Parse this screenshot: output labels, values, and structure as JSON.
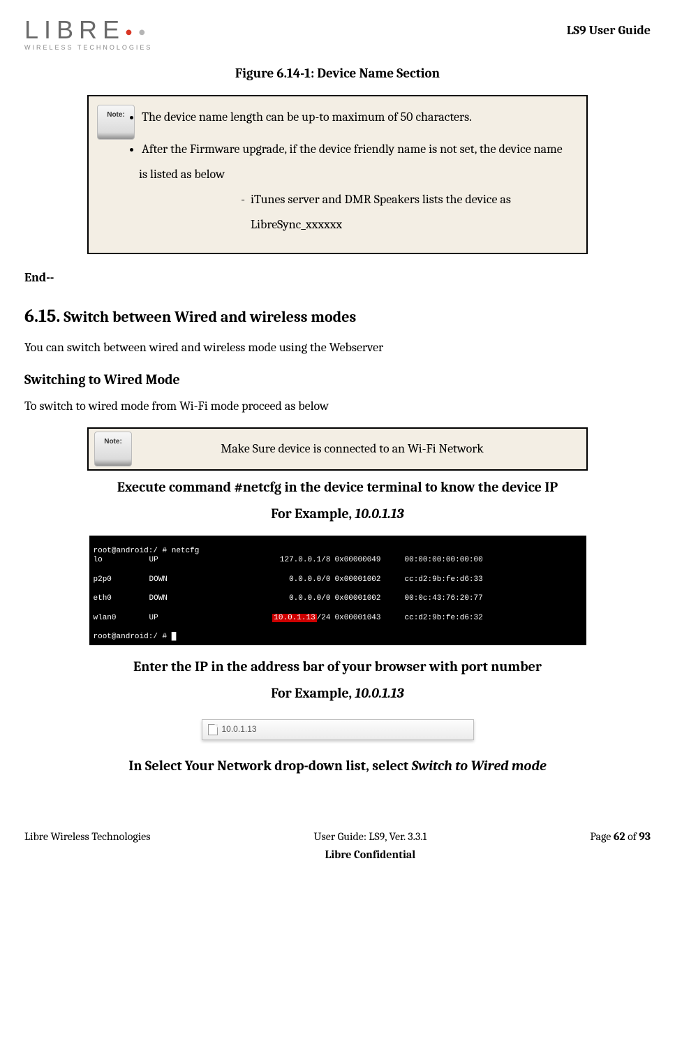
{
  "header": {
    "logo_main": "LIBRE",
    "logo_sub": "WIRELESS TECHNOLOGIES",
    "doc_title": "LS9 User Guide"
  },
  "figure_caption": "Figure 6.14-1: Device Name Section",
  "note1": {
    "icon_label": "Note:",
    "bullet1": "The device name length can be up-to maximum of 50 characters.",
    "bullet2": "After the Firmware upgrade, if the device friendly name is not set,  the device name is listed as below",
    "sub_bullet": "iTunes server and DMR Speakers lists the device as LibreSync_xxxxxx"
  },
  "end_text": "End--",
  "section": {
    "number": "6.15.",
    "title": "Switch between Wired and wireless modes",
    "intro": "You can switch between wired and wireless mode using the Webserver",
    "sub_heading": "Switching to Wired Mode",
    "sub_intro": "To switch to wired mode from Wi-Fi mode proceed as below"
  },
  "note2": {
    "icon_label": "Note:",
    "text": "Make Sure device is connected to an Wi-Fi Network"
  },
  "step1": {
    "line1": "Execute command #netcfg in the device terminal to know the device IP",
    "line2_prefix": "For Example, ",
    "line2_ip": "10.0.1.13"
  },
  "terminal": {
    "prompt1": "root@android:/ # ",
    "cmd": "netcfg",
    "rows": [
      {
        "if": "lo",
        "st": "UP",
        "ip": "127.0.0.1/8",
        "flags": "0x00000049",
        "mac": "00:00:00:00:00:00"
      },
      {
        "if": "p2p0",
        "st": "DOWN",
        "ip": "0.0.0.0/0",
        "flags": "0x00001002",
        "mac": "cc:d2:9b:fe:d6:33"
      },
      {
        "if": "eth0",
        "st": "DOWN",
        "ip": "0.0.0.0/0",
        "flags": "0x00001002",
        "mac": "00:0c:43:76:20:77"
      },
      {
        "if": "wlan0",
        "st": "UP",
        "ip_pre": "",
        "ip_hl": "10.0.1.13",
        "ip_post": "/24",
        "flags": "0x00001043",
        "mac": "cc:d2:9b:fe:d6:32"
      }
    ],
    "prompt2": "root@android:/ # "
  },
  "step2": {
    "line1": "Enter the IP in the address bar of your browser with port number",
    "line2_prefix": "For Example, ",
    "line2_ip": "10.0.1.13"
  },
  "url_tab": "10.0.1.13",
  "step3": {
    "prefix": "In Select Your Network drop-down list, select ",
    "action": "Switch to Wired mode"
  },
  "footer": {
    "left": "Libre Wireless Technologies",
    "center1": "User Guide: LS9, Ver. 3.3.1",
    "center2": "Libre Confidential",
    "right_prefix": "Page ",
    "right_page": "62",
    "right_mid": " of ",
    "right_total": "93"
  }
}
